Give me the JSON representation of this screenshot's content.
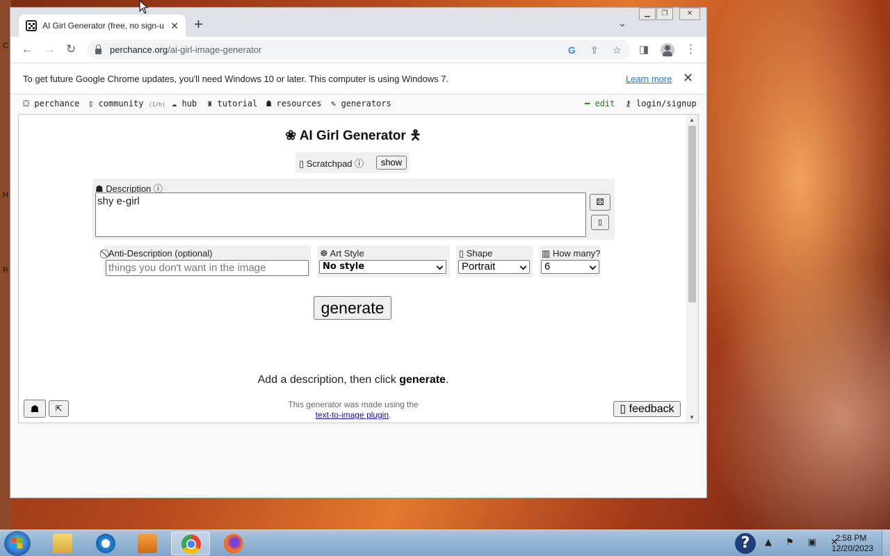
{
  "desktop": {
    "side_glyphs": [
      "C",
      "H",
      "R"
    ]
  },
  "browser": {
    "tab": {
      "title": "AI Girl Generator (free, no sign-up"
    },
    "url": {
      "domain": "perchance.org",
      "path": "/ai-girl-image-generator"
    },
    "infobar": {
      "message": "To get future Google Chrome updates, you'll need Windows 10 or later. This computer is using Windows 7.",
      "link": "Learn more"
    }
  },
  "perchance_nav": {
    "items": [
      {
        "icon": "⛋",
        "label": "perchance"
      },
      {
        "icon": "▯",
        "label": "community",
        "meta": "(1/h)"
      },
      {
        "icon": "☁",
        "label": "hub"
      },
      {
        "icon": "♜",
        "label": "tutorial"
      },
      {
        "icon": "☗",
        "label": "resources"
      },
      {
        "icon": "✎",
        "label": "generators"
      }
    ],
    "edit": "edit",
    "login": "login/signup"
  },
  "generator": {
    "title": "❀ AI Girl Generator 🯅",
    "scratchpad": {
      "label": "▯ Scratchpad ⓘ",
      "show_button": "show"
    },
    "description": {
      "label": "☗ Description ⓘ",
      "value": "shy e-girl",
      "dice_button": "⚄",
      "clear_button": "▯"
    },
    "anti_description": {
      "label": "⃠ Anti-Description (optional)",
      "placeholder": "things you don't want in the image"
    },
    "art_style": {
      "label": "☸ Art Style",
      "selected": "No style"
    },
    "shape": {
      "label": "▯ Shape",
      "selected": "Portrait"
    },
    "how_many": {
      "label": "▥ How many?",
      "selected": "6"
    },
    "generate_button": "generate",
    "hint_prefix": "Add a description, then click ",
    "hint_bold": "generate",
    "hint_suffix": ".",
    "footer_text": "This generator was made using the",
    "footer_link": "text-to-image plugin",
    "footer_suffix": ".",
    "gallery_button": "☗",
    "expand_button": "⇱",
    "feedback_button": "▯ feedback"
  },
  "taskbar": {
    "tray_help": "?",
    "tray_icons": "▲ ⚑ ▣ ✕",
    "time": "2:58 PM",
    "date": "12/20/2023"
  },
  "colors": {
    "chrome_blue": "#1a73e8",
    "tab_strip": "#dee1e6",
    "taskbar": "#8fb1d2"
  }
}
